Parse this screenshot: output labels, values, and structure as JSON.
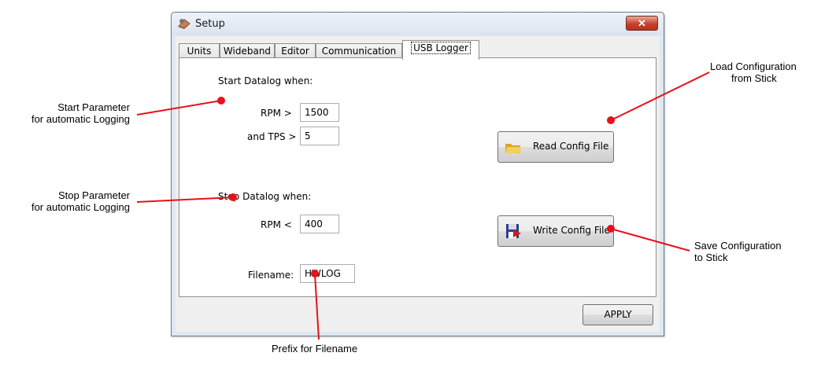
{
  "window": {
    "title": "Setup",
    "close_symbol": "✕"
  },
  "tabs": [
    {
      "label": "Units"
    },
    {
      "label": "Wideband"
    },
    {
      "label": "Editor"
    },
    {
      "label": "Communication"
    },
    {
      "label": "USB Logger"
    }
  ],
  "start": {
    "heading": "Start Datalog when:",
    "rpm_label": "RPM >",
    "rpm_value": "1500",
    "tps_label": "and TPS >",
    "tps_value": "5"
  },
  "stop": {
    "heading": "Stop Datalog when:",
    "rpm_label": "RPM <",
    "rpm_value": "400"
  },
  "filename": {
    "label": "Filename:",
    "value": "HWLOG"
  },
  "buttons": {
    "read": "Read Config File",
    "write": "Write Config File",
    "apply": "APPLY"
  },
  "callouts": {
    "start": [
      "Start Parameter",
      "for automatic Logging"
    ],
    "stop": [
      "Stop Parameter",
      "for automatic Logging"
    ],
    "load": [
      "Load Configuration",
      "from Stick"
    ],
    "save": [
      "Save Configuration",
      "to Stick"
    ],
    "prefix": "Prefix for Filename"
  },
  "colors": {
    "callout_line": "#e8101a",
    "accent": "#d40000"
  },
  "icons": {
    "app": "setup-gear-icon",
    "read": "folder-icon",
    "write": "floppy-disk-icon"
  }
}
